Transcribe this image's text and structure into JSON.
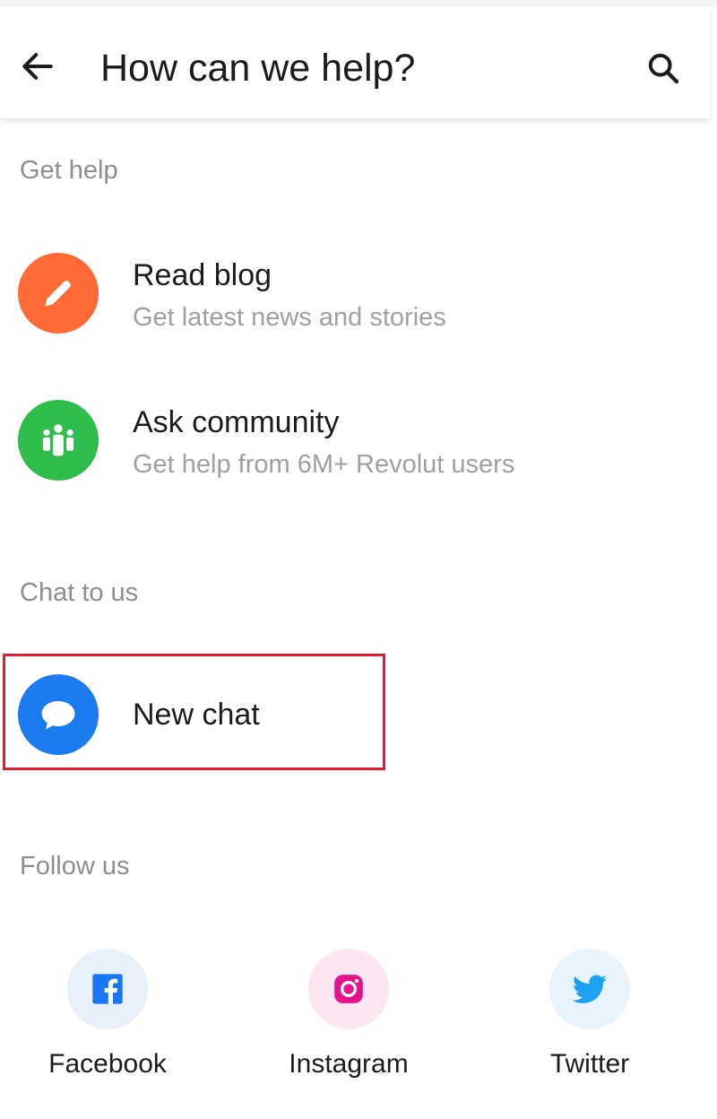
{
  "header": {
    "title": "How can we help?"
  },
  "sections": {
    "get_help": "Get help",
    "chat_to_us": "Chat to us",
    "follow_us": "Follow us"
  },
  "get_help_items": [
    {
      "title": "Read blog",
      "subtitle": "Get latest news and stories",
      "icon": "pencil-icon",
      "color": "#ff6b35"
    },
    {
      "title": "Ask community",
      "subtitle": "Get help from 6M+ Revolut users",
      "icon": "community-icon",
      "color": "#2ebd4a"
    }
  ],
  "chat": {
    "title": "New chat",
    "icon": "chat-bubble-icon",
    "color": "#1a7cf0"
  },
  "social": [
    {
      "label": "Facebook",
      "icon": "facebook-icon",
      "color": "#1877f2"
    },
    {
      "label": "Instagram",
      "icon": "instagram-icon",
      "color": "#e6138c"
    },
    {
      "label": "Twitter",
      "icon": "twitter-icon",
      "color": "#1da1f2"
    }
  ]
}
